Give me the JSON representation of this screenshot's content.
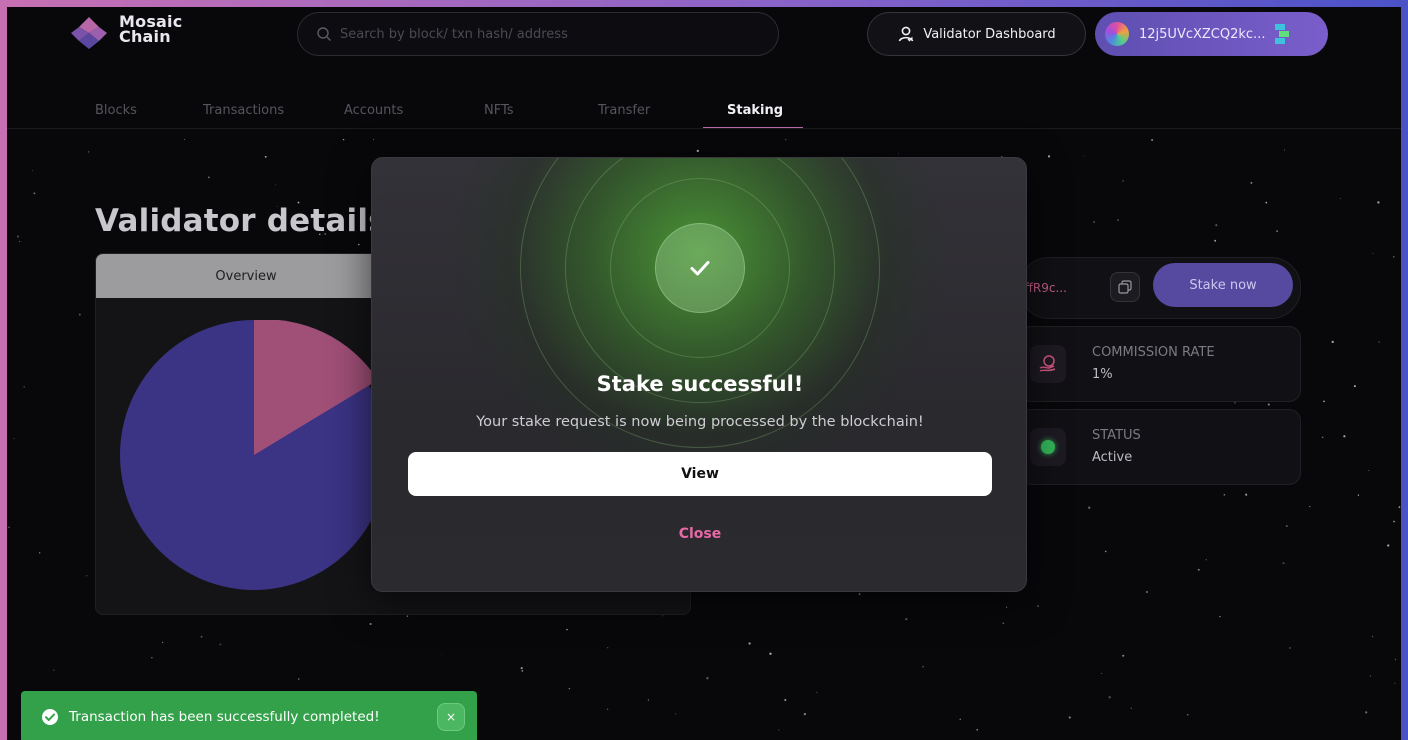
{
  "header": {
    "logo_line1": "Mosaic",
    "logo_line2": "Chain",
    "search_placeholder": "Search by block/ txn hash/ address",
    "validator_dashboard_label": "Validator Dashboard",
    "wallet_address": "12j5UVcXZCQ2kc..."
  },
  "nav": {
    "tabs": [
      {
        "label": "Blocks"
      },
      {
        "label": "Transactions"
      },
      {
        "label": "Accounts"
      },
      {
        "label": "NFTs"
      },
      {
        "label": "Transfer"
      },
      {
        "label": "Staking"
      }
    ],
    "active": "Staking"
  },
  "page": {
    "title": "Validator details",
    "overview_tab": "Overview",
    "address_fragment": "nffR9c...",
    "stake_button": "Stake now",
    "commission_label": "COMMISSION RATE",
    "commission_value": "1%",
    "status_label": "STATUS",
    "status_value": "Active"
  },
  "modal": {
    "title": "Stake successful!",
    "message": "Your stake request is now being processed by the blockchain!",
    "view_button": "View",
    "close_link": "Close"
  },
  "toast": {
    "message": "Transaction has been successfully completed!",
    "close_symbol": "×"
  },
  "colors": {
    "accent_purple": "#5e4fb1",
    "nav_underline": "#b96ba7",
    "success_green": "#33a04a",
    "close_pink": "#e76aa6",
    "pie_main": "#3b3384",
    "pie_slice": "#a04f77"
  },
  "icons": {
    "search": "search-icon",
    "dashboard": "user-icon",
    "copy": "copy-icon",
    "commission": "coin-hand-icon",
    "check": "check-icon",
    "toast_ok": "check-circle-icon",
    "close": "close-icon"
  }
}
